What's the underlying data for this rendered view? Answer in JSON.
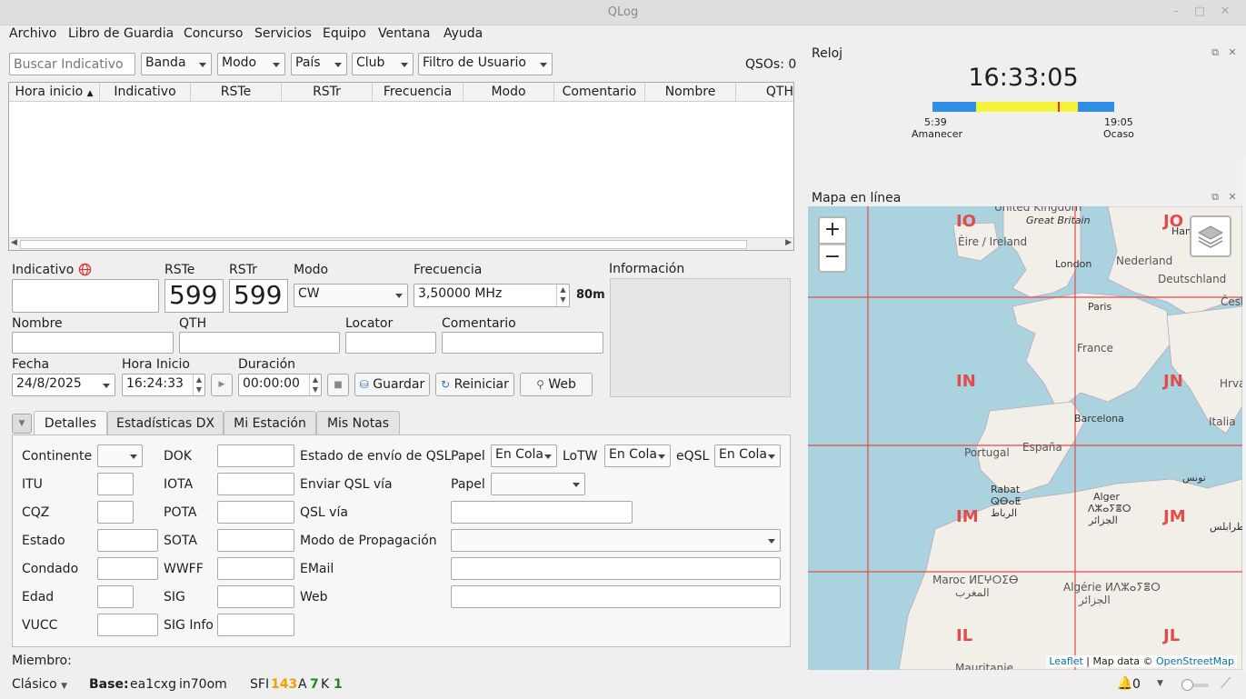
{
  "window": {
    "title": "QLog",
    "minimize_icon": "minimize-icon",
    "maximize_icon": "maximize-icon",
    "close_icon": "close-icon"
  },
  "menu": [
    "Archivo",
    "Libro de Guardia",
    "Concurso",
    "Servicios",
    "Equipo",
    "Ventana",
    "Ayuda"
  ],
  "filters": {
    "search_placeholder": "Buscar Indicativo",
    "band": "Banda",
    "mode": "Modo",
    "country": "País",
    "club": "Club",
    "user_filter": "Filtro de Usuario",
    "qso_count": "QSOs: 0"
  },
  "table": {
    "columns": [
      "Hora inicio",
      "Indicativo",
      "RSTe",
      "RSTr",
      "Frecuencia",
      "Modo",
      "Comentario",
      "Nombre",
      "QTH"
    ]
  },
  "form": {
    "callsign_label": "Indicativo",
    "rst_sent_label": "RSTe",
    "rst_sent_value": "599",
    "rst_rcvd_label": "RSTr",
    "rst_rcvd_value": "599",
    "mode_label": "Modo",
    "mode_value": "CW",
    "freq_label": "Frecuencia",
    "freq_value": "3,50000 MHz",
    "band_value": "80m",
    "info_label": "Información",
    "name_label": "Nombre",
    "qth_label": "QTH",
    "locator_label": "Locator",
    "comment_label": "Comentario",
    "date_label": "Fecha",
    "date_value": "24/8/2025",
    "start_label": "Hora Inicio",
    "start_value": "16:24:33",
    "duration_label": "Duración",
    "duration_value": "00:00:00",
    "save_label": "Guardar",
    "reset_label": "Reiniciar",
    "web_label": "Web"
  },
  "tabs": [
    "Detalles",
    "Estadísticas DX",
    "Mi Estación",
    "Mis Notas"
  ],
  "details": {
    "col1": [
      "Continente",
      "ITU",
      "CQZ",
      "Estado",
      "Condado",
      "Edad",
      "VUCC"
    ],
    "col2": [
      "DOK",
      "IOTA",
      "POTA",
      "SOTA",
      "WWFF",
      "SIG",
      "SIG Info"
    ],
    "qsl_send_status": "Estado de envío de QSL",
    "paper_label": "Papel",
    "paper_value": "En Cola",
    "lotw_label": "LoTW",
    "lotw_value": "En Cola",
    "eqsl_label": "eQSL",
    "eqsl_value": "En Cola",
    "send_qsl_via": "Enviar QSL vía",
    "send_paper_label": "Papel",
    "qsl_via": "QSL vía",
    "propagation_mode": "Modo de Propagación",
    "email": "EMail",
    "web": "Web"
  },
  "member_label": "Miembro:",
  "status": {
    "layout": "Clásico",
    "base_label": "Base:",
    "base_call": "ea1cxg",
    "base_grid": "in70om",
    "sfi_label": "SFI",
    "sfi_value": "143",
    "a_label": "A",
    "a_value": "7",
    "k_label": "K",
    "k_value": "1",
    "alerts": "0"
  },
  "clock": {
    "title": "Reloj",
    "time": "16:33:05",
    "sunrise_time": "5:39",
    "sunrise_label": "Amanecer",
    "sunset_time": "19:05",
    "sunset_label": "Ocaso"
  },
  "map": {
    "title": "Mapa en línea",
    "zoom_in": "+",
    "zoom_out": "−",
    "grid_squares": [
      "IO",
      "JO",
      "IN",
      "JN",
      "IM",
      "JM",
      "IL",
      "JL"
    ],
    "places": [
      "United Kingdom",
      "Great Britain",
      "Éire / Ireland",
      "London",
      "Nederland",
      "Deutschland",
      "Hambu",
      "Paris",
      "France",
      "Hrvats",
      "Barcelona",
      "Italia",
      "Portugal",
      "España",
      "Rabat",
      "ⵕⴱⴰⵟ",
      "الرباط",
      "Alger",
      "ⴷⵣⴰⵢⴻⵔ",
      "الجزائر",
      "تونس",
      "طرابلس",
      "Maroc ⵍⵎⵖⵔⵉⴱ",
      "المغرب",
      "Algérie ⵍⴷⵣⴰⵢⴻⵔ",
      "الجزائر",
      "Mauritanie",
      "Česk"
    ],
    "attribution_leaflet": "Leaflet",
    "attribution_text": " | Map data © ",
    "attribution_osm": "OpenStreetMap"
  },
  "colors": {
    "accent_orange": "#f0a000",
    "accent_green": "#1c8a1c",
    "grid_red": "#e34b4b",
    "sea": "#aad3df",
    "land": "#f2efe9"
  }
}
